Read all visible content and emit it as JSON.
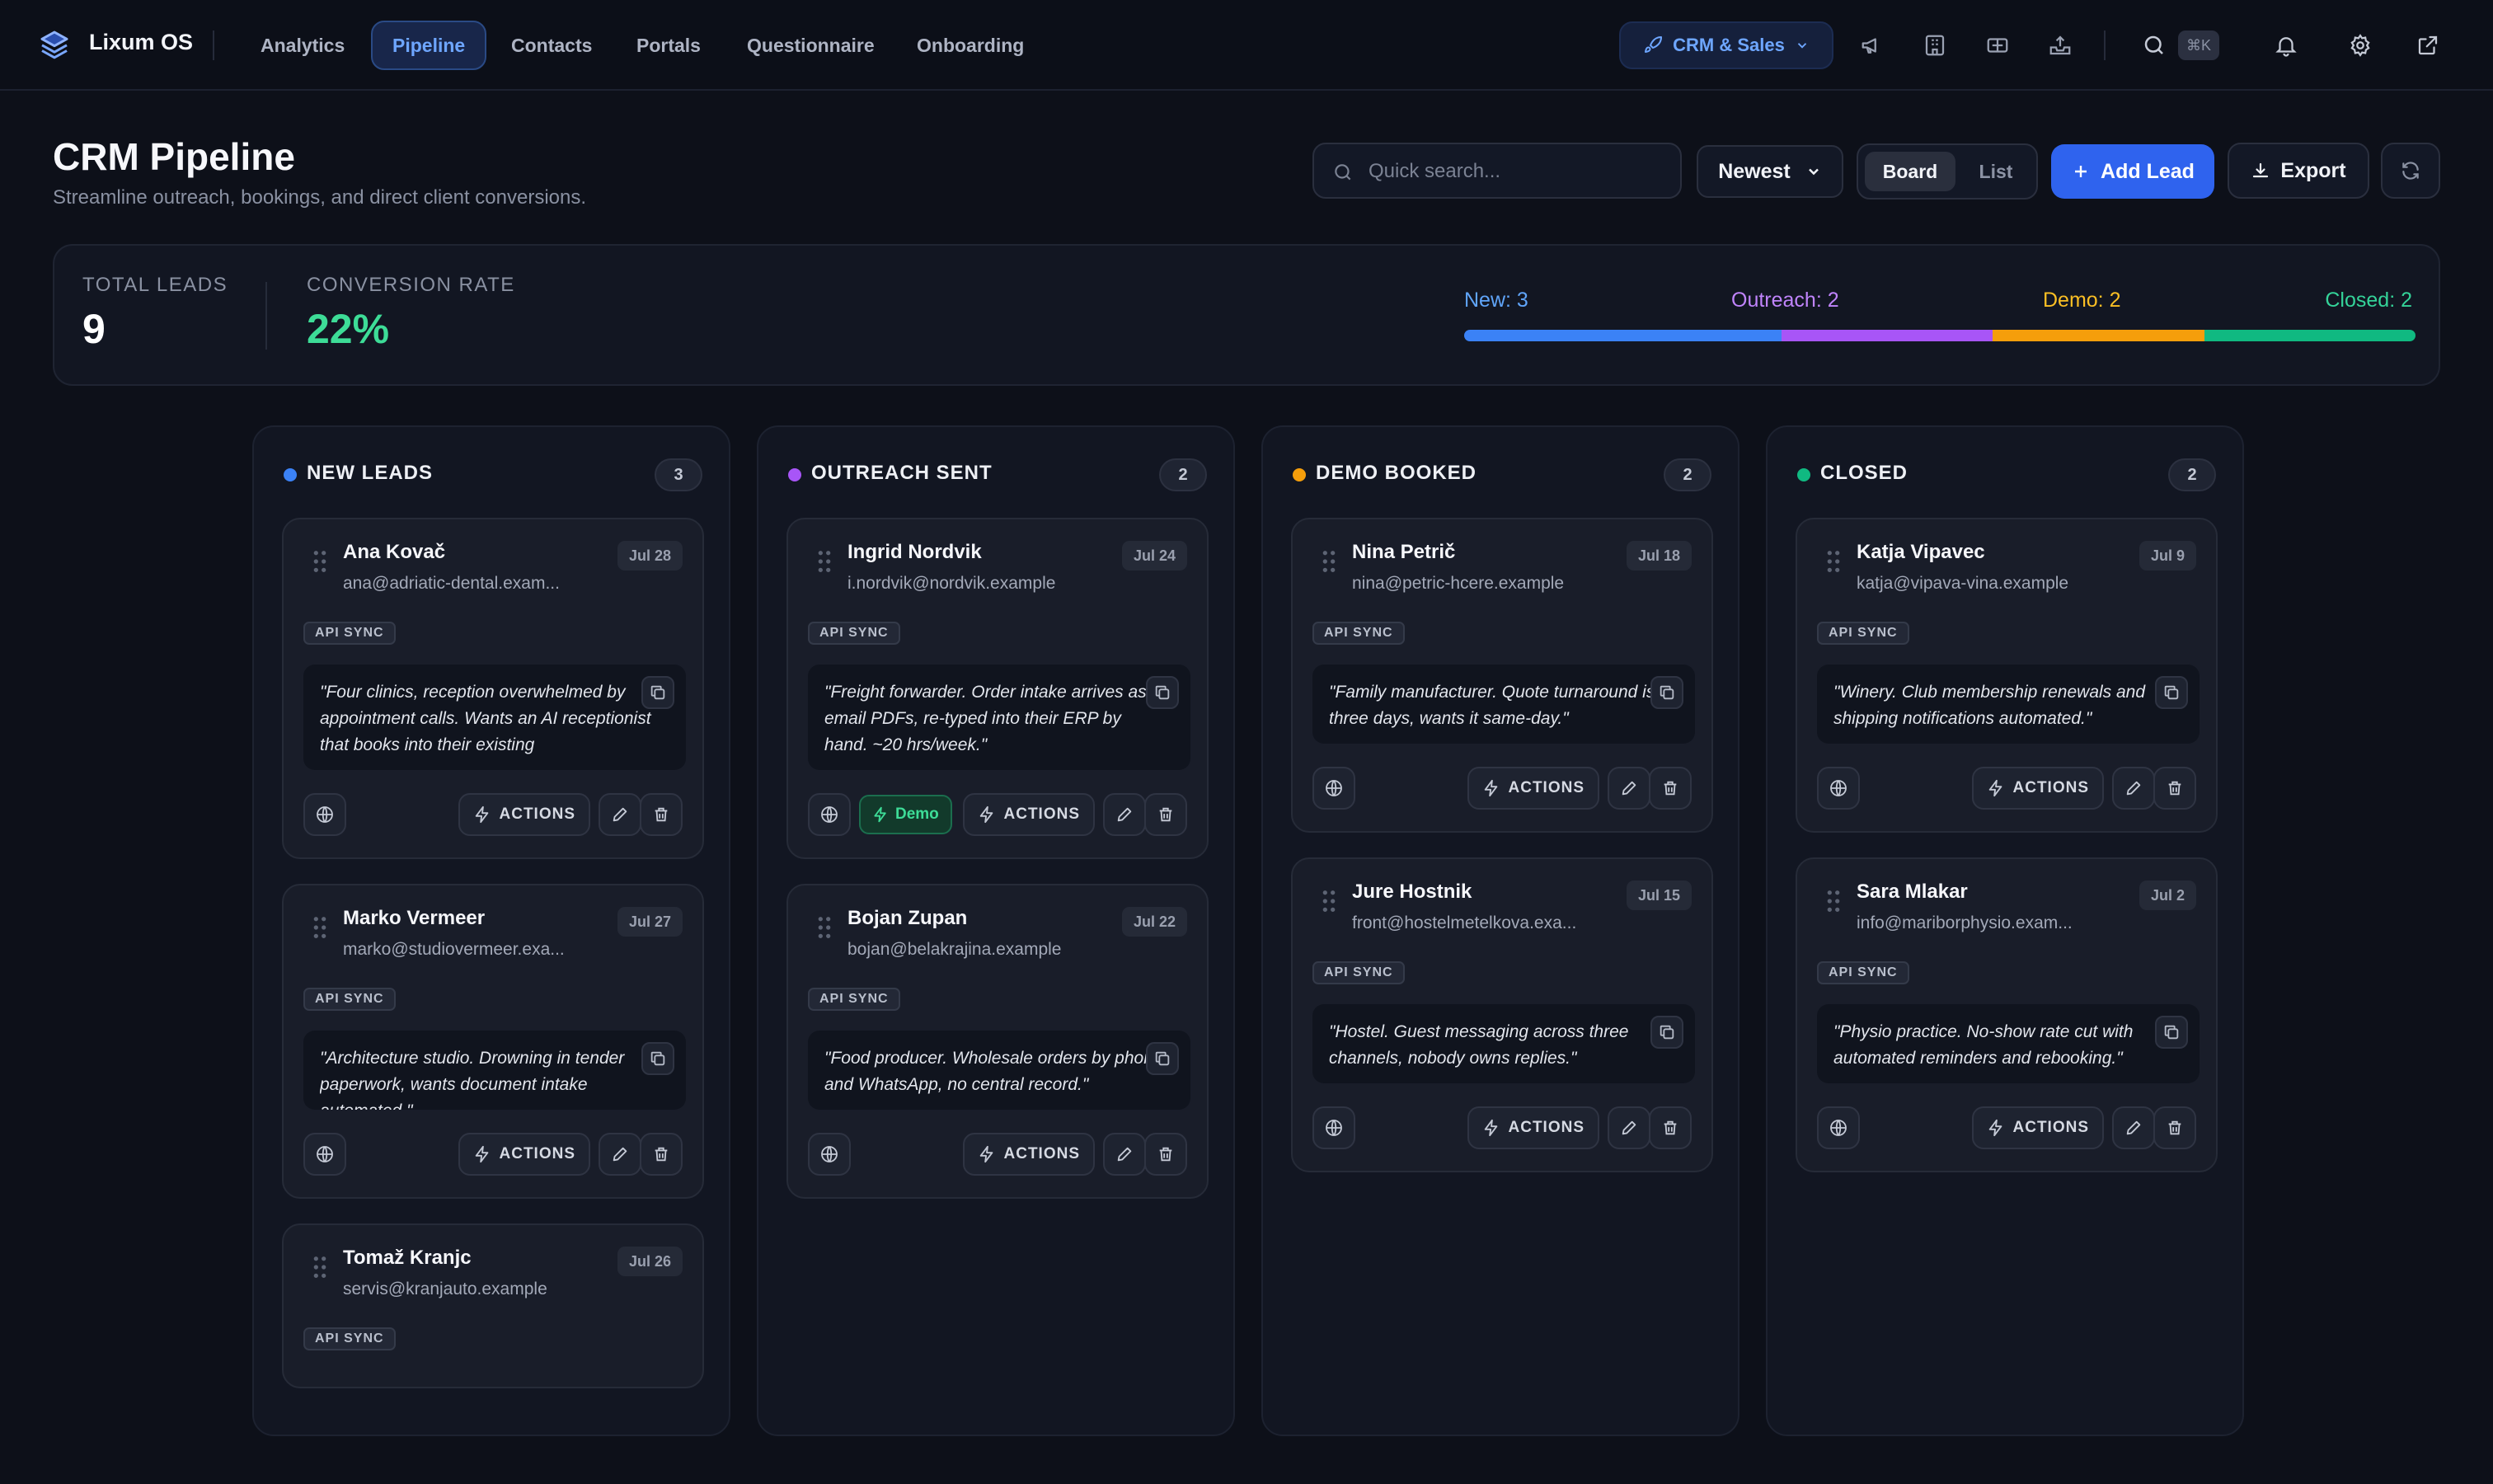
{
  "app": {
    "name": "Lixum OS"
  },
  "nav": [
    {
      "label": "Analytics",
      "active": false
    },
    {
      "label": "Pipeline",
      "active": true
    },
    {
      "label": "Contacts",
      "active": false
    },
    {
      "label": "Portals",
      "active": false
    },
    {
      "label": "Questionnaire",
      "active": false
    },
    {
      "label": "Onboarding",
      "active": false
    }
  ],
  "workspace": {
    "label": "CRM & Sales",
    "icon": "rocket-icon"
  },
  "shortcut": "⌘K",
  "page": {
    "title": "CRM Pipeline",
    "subtitle": "Streamline outreach, bookings, and direct client conversions."
  },
  "toolbar": {
    "search_placeholder": "Quick search...",
    "sort_value": "Newest",
    "view_board": "Board",
    "view_list": "List",
    "add_lead": "Add Lead",
    "export": "Export"
  },
  "stats": {
    "total_label": "TOTAL LEADS",
    "total_value": "9",
    "conversion_label": "CONVERSION RATE",
    "conversion_value": "22%",
    "legend": [
      {
        "label": "New: 3",
        "count": 3,
        "color": "#3b82f6"
      },
      {
        "label": "Outreach: 2",
        "count": 2,
        "color": "#a855f7"
      },
      {
        "label": "Demo: 2",
        "count": 2,
        "color": "#f59e0b"
      },
      {
        "label": "Closed: 2",
        "count": 2,
        "color": "#10b981"
      }
    ]
  },
  "columns": [
    {
      "title": "NEW LEADS",
      "count": "3",
      "color": "#3b82f6",
      "cards": [
        {
          "name": "Ana Kovač",
          "email": "ana@adriatic-dental.exam...",
          "date": "Jul 28",
          "tag": "API SYNC",
          "quote": "\"Four clinics, reception overwhelmed by appointment calls. Wants an AI receptionist that books into their existing",
          "actions": "ACTIONS"
        },
        {
          "name": "Marko Vermeer",
          "email": "marko@studiovermeer.exa...",
          "date": "Jul 27",
          "tag": "API SYNC",
          "quote": "\"Architecture studio. Drowning in tender paperwork, wants document intake automated.\"",
          "actions": "ACTIONS"
        },
        {
          "name": "Tomaž Kranjc",
          "email": "servis@kranjauto.example",
          "date": "Jul 26",
          "tag": "API SYNC"
        }
      ]
    },
    {
      "title": "OUTREACH SENT",
      "count": "2",
      "color": "#a855f7",
      "cards": [
        {
          "name": "Ingrid Nordvik",
          "email": "i.nordvik@nordvik.example",
          "date": "Jul 24",
          "tag": "API SYNC",
          "quote": "\"Freight forwarder. Order intake arrives as email PDFs, re-typed into their ERP by hand. ~20 hrs/week.\"",
          "badge": "Demo",
          "actions": "ACTIONS"
        },
        {
          "name": "Bojan Zupan",
          "email": "bojan@belakrajina.example",
          "date": "Jul 22",
          "tag": "API SYNC",
          "quote": "\"Food producer. Wholesale orders by phone and WhatsApp, no central record.\"",
          "actions": "ACTIONS"
        }
      ]
    },
    {
      "title": "DEMO BOOKED",
      "count": "2",
      "color": "#f59e0b",
      "cards": [
        {
          "name": "Nina Petrič",
          "email": "nina@petric-hcere.example",
          "date": "Jul 18",
          "tag": "API SYNC",
          "quote": "\"Family manufacturer. Quote turnaround is three days, wants it same-day.\"",
          "actions": "ACTIONS"
        },
        {
          "name": "Jure Hostnik",
          "email": "front@hostelmetelkova.exa...",
          "date": "Jul 15",
          "tag": "API SYNC",
          "quote": "\"Hostel. Guest messaging across three channels, nobody owns replies.\"",
          "actions": "ACTIONS"
        }
      ]
    },
    {
      "title": "CLOSED",
      "count": "2",
      "color": "#10b981",
      "cards": [
        {
          "name": "Katja Vipavec",
          "email": "katja@vipava-vina.example",
          "date": "Jul 9",
          "tag": "API SYNC",
          "quote": "\"Winery. Club membership renewals and shipping notifications automated.\"",
          "actions": "ACTIONS"
        },
        {
          "name": "Sara Mlakar",
          "email": "info@mariborphysio.exam...",
          "date": "Jul 2",
          "tag": "API SYNC",
          "quote": "\"Physio practice. No-show rate cut with automated reminders and rebooking.\"",
          "actions": "ACTIONS"
        }
      ]
    }
  ]
}
